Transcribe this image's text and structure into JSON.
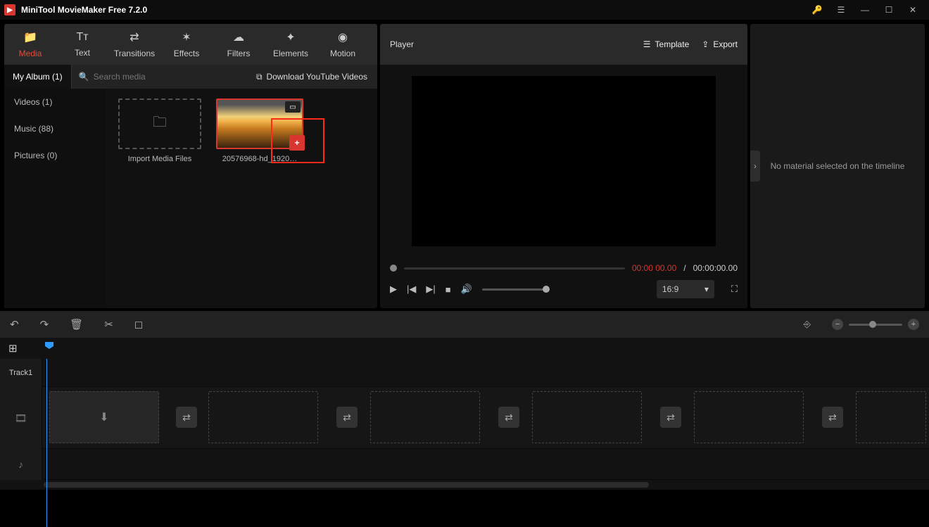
{
  "titlebar": {
    "app_title": "MiniTool MovieMaker Free 7.2.0"
  },
  "tabs": [
    {
      "label": "Media",
      "icon": "folder"
    },
    {
      "label": "Text",
      "icon": "text"
    },
    {
      "label": "Transitions",
      "icon": "transition"
    },
    {
      "label": "Effects",
      "icon": "effects"
    },
    {
      "label": "Filters",
      "icon": "filters"
    },
    {
      "label": "Elements",
      "icon": "elements"
    },
    {
      "label": "Motion",
      "icon": "motion"
    }
  ],
  "subbar": {
    "album_label": "My Album (1)",
    "search_placeholder": "Search media",
    "download_label": "Download YouTube Videos"
  },
  "categories": [
    {
      "label": "My Album (1)",
      "active": true
    },
    {
      "label": "Videos (1)"
    },
    {
      "label": "Music (88)"
    },
    {
      "label": "Pictures (0)"
    }
  ],
  "media": {
    "import_label": "Import Media Files",
    "clip_label": "20576968-hd_1920…"
  },
  "player": {
    "title": "Player",
    "template_label": "Template",
    "export_label": "Export",
    "time_current": "00:00 00.00",
    "time_sep": " / ",
    "time_total": "00:00:00.00",
    "ratio": "16:9"
  },
  "sidepanel": {
    "message": "No material selected on the timeline"
  },
  "timeline": {
    "track1_label": "Track1"
  }
}
